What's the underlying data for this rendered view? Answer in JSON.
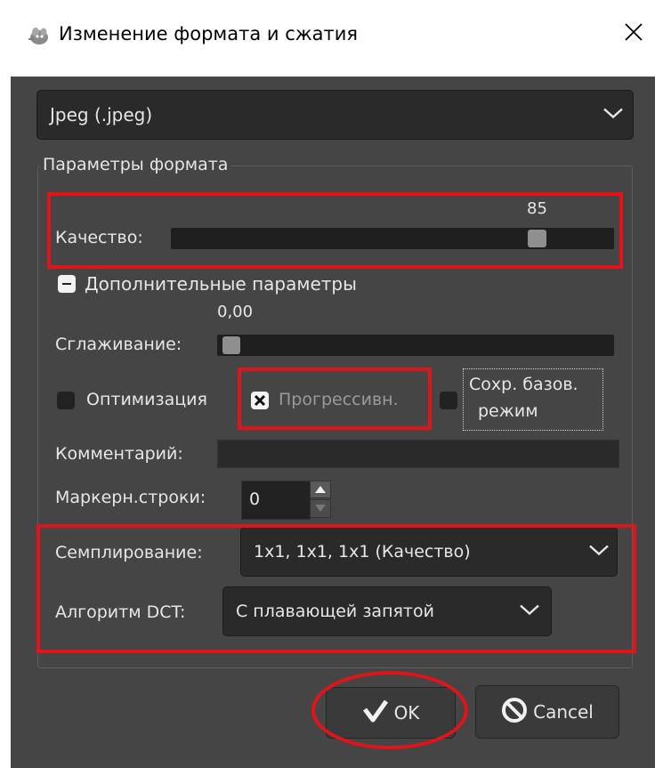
{
  "window": {
    "title": "Изменение формата и сжатия"
  },
  "format_combo": {
    "value": "Jpeg (.jpeg)"
  },
  "format_params": {
    "title": "Параметры формата",
    "quality": {
      "label": "Качество:",
      "value_text": "85",
      "value": 85,
      "max": 100
    },
    "advanced_toggle": {
      "label": "Дополнительные параметры"
    },
    "smoothing": {
      "label": "Сглаживание:",
      "value_text": "0,00",
      "value": 0.0,
      "max": 1.0
    },
    "optimize": {
      "label": "Оптимизация",
      "checked": false
    },
    "progressive": {
      "label": "Прогрессивн.",
      "checked": true
    },
    "save_baseline": {
      "label_line1": "Сохр. базов.",
      "label_line2": "режим",
      "checked": false
    },
    "comment": {
      "label": "Комментарий:",
      "value": ""
    },
    "restart_markers": {
      "label": "Маркерн.строки:",
      "value": "0"
    },
    "subsampling": {
      "label": "Семплирование:",
      "value": "1x1, 1x1, 1x1 (Качество)"
    },
    "dct": {
      "label": "Алгоритм DCT:",
      "value": "С плавающей запятой"
    }
  },
  "buttons": {
    "ok": {
      "label": "OK"
    },
    "cancel": {
      "label": "Cancel"
    }
  },
  "icons": {
    "app": "gimp-icon",
    "close": "close-icon",
    "ok": "check-icon",
    "cancel": "cancel-icon"
  },
  "colors": {
    "highlight": "#e1141b",
    "panel": "#454545",
    "field": "#2a2a2a",
    "text": "#e6e6e6"
  }
}
